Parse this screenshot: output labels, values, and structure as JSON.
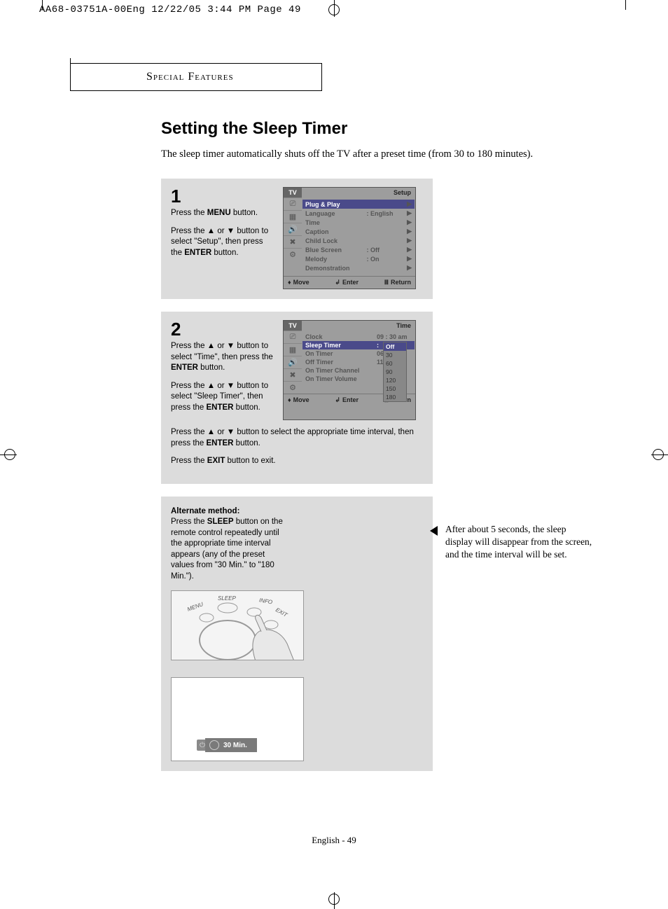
{
  "print_header": "AA68-03751A-00Eng  12/22/05  3:44 PM  Page 49",
  "section_tab": "Special Features",
  "title": "Setting the Sleep Timer",
  "intro": "The sleep timer automatically shuts off the TV after a preset time (from 30 to 180 minutes).",
  "step1": {
    "num": "1",
    "p1_a": "Press the ",
    "p1_b": "MENU",
    "p1_c": " button.",
    "p2_a": "Press the ▲ or ▼ button to select \"Setup\", then press the ",
    "p2_b": "ENTER",
    "p2_c": " button."
  },
  "osd1": {
    "tab": "TV",
    "title": "Setup",
    "rows": [
      {
        "label": "Plug & Play",
        "value": "",
        "sel": true
      },
      {
        "label": "Language",
        "value": ":  English"
      },
      {
        "label": "Time",
        "value": ""
      },
      {
        "label": "Caption",
        "value": ""
      },
      {
        "label": "Child Lock",
        "value": ""
      },
      {
        "label": "Blue Screen",
        "value": ":  Off"
      },
      {
        "label": "Melody",
        "value": ":  On"
      },
      {
        "label": "Demonstration",
        "value": ""
      }
    ],
    "footer": {
      "move": "Move",
      "enter": "Enter",
      "return": "Return"
    }
  },
  "step2": {
    "num": "2",
    "p1_a": "Press the ▲ or ▼ button to select \"Time\", then press the ",
    "p1_b": "ENTER",
    "p1_c": " button.",
    "p2_a": "Press the ▲ or ▼ button to select \"Sleep Timer\", then press the ",
    "p2_b": "ENTER",
    "p2_c": " button.",
    "below1_a": "Press the ▲ or ▼ button to select  the appropriate time interval, then press the ",
    "below1_b": "ENTER",
    "below1_c": " button.",
    "below2_a": "Press the ",
    "below2_b": "EXIT",
    "below2_c": " button to exit."
  },
  "osd2": {
    "tab": "TV",
    "title": "Time",
    "rows": [
      {
        "label": "Clock",
        "value": "09 : 30 am"
      },
      {
        "label": "Sleep Timer",
        "value": ":",
        "sel": true
      },
      {
        "label": "On Timer",
        "value": "06 :"
      },
      {
        "label": "Off Timer",
        "value": "11 :"
      },
      {
        "label": "On Timer Channel",
        "value": ""
      },
      {
        "label": "On Timer Volume",
        "value": ""
      }
    ],
    "dropdown": [
      "Off",
      "30",
      "60",
      "90",
      "120",
      "150",
      "180"
    ],
    "dropdown_sel": "Off",
    "footer": {
      "move": "Move",
      "enter": "Enter",
      "return": "Return"
    }
  },
  "alt": {
    "head": "Alternate method:",
    "body_a": "Press the ",
    "body_b": "SLEEP",
    "body_c": " button on the remote control repeatedly until the appropriate time interval appears (any of the preset values from \"30 Min.\" to \"180 Min.\").",
    "remote_labels": {
      "menu": "MENU",
      "sleep": "SLEEP",
      "info": "INFO",
      "exit": "EXIT"
    },
    "mini_osd": "30 Min."
  },
  "note_right": "After about 5 seconds, the sleep display will disappear from the screen, and the time interval will be set.",
  "footer_page": "English - 49"
}
